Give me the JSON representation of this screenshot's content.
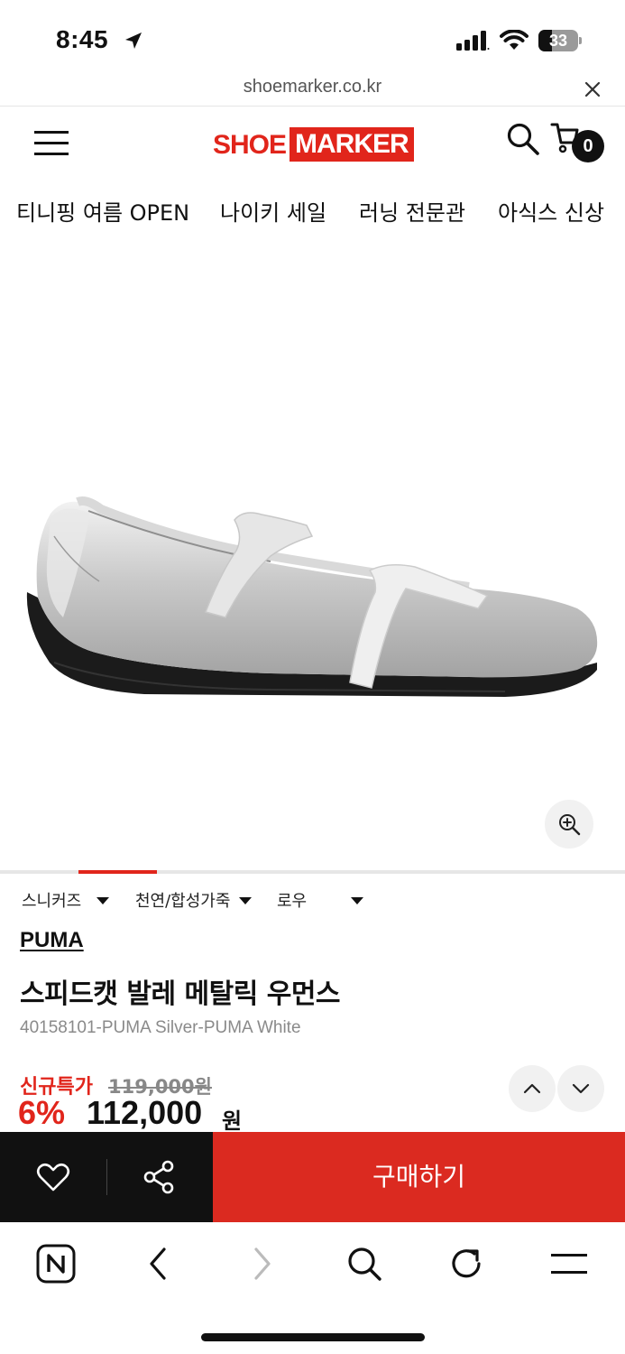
{
  "status_bar": {
    "time": "8:45",
    "battery": "33",
    "battery_level": 0.33
  },
  "browser": {
    "url": "shoemarker.co.kr"
  },
  "header": {
    "logo_part1": "SHOE",
    "logo_part2": "MARKER",
    "cart_count": "0"
  },
  "category_nav": [
    {
      "label": "티니핑 여름 OPEN"
    },
    {
      "label": "나이키 세일"
    },
    {
      "label": "러닝 전문관"
    },
    {
      "label": "아식스 신상"
    }
  ],
  "gallery": {
    "progress_fraction": 0.125
  },
  "product": {
    "tags": [
      "스니커즈",
      "천연/합성가죽",
      "로우"
    ],
    "brand": "PUMA",
    "name": "스피드캣 발레 메탈릭 우먼스",
    "code": "40158101-PUMA Silver-PUMA White",
    "price_label": "신규특가",
    "original_price": "119,000원",
    "discount": "6%",
    "price": "112,000",
    "price_unit": "원"
  },
  "actions": {
    "buy_label": "구매하기"
  },
  "colors": {
    "accent": "#e1251b",
    "buy": "#db2a20",
    "dark": "#111111"
  }
}
